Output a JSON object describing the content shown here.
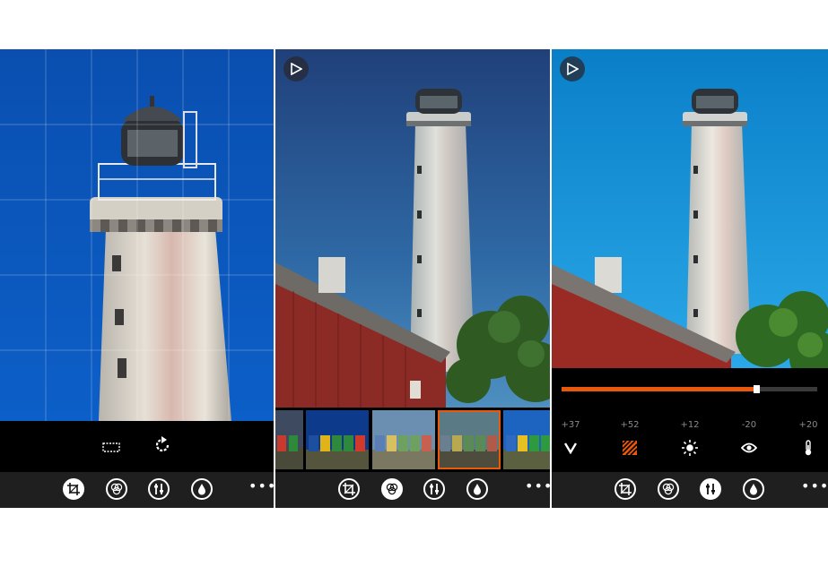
{
  "panels": [
    {
      "name": "crop",
      "tools": [
        {
          "icon": "crop-frame-icon"
        },
        {
          "icon": "rotate-icon"
        }
      ],
      "appbar_active": "crop"
    },
    {
      "name": "filters",
      "play_icon": "play-icon",
      "appbar_active": "filters",
      "filters": [
        {
          "selected": false
        },
        {
          "selected": false
        },
        {
          "selected": false
        },
        {
          "selected": true
        },
        {
          "selected": false
        }
      ]
    },
    {
      "name": "adjust",
      "play_icon": "play-icon",
      "appbar_active": "adjust",
      "slider": {
        "level": 0.76
      },
      "adjustments": [
        {
          "value": "+37",
          "icon": "vignette-v-icon"
        },
        {
          "value": "+52",
          "icon": "texture-stripes-icon"
        },
        {
          "value": "+12",
          "icon": "brightness-sun-icon"
        },
        {
          "value": "-20",
          "icon": "eye-icon"
        },
        {
          "value": "+20",
          "icon": "thermometer-icon"
        }
      ]
    }
  ],
  "appbar": {
    "buttons": [
      "crop-icon",
      "filters-icon",
      "adjust-icon",
      "color-drop-icon"
    ],
    "more": "•••"
  },
  "colors": {
    "accent": "#e8590c",
    "appbar": "#1f1f1f"
  }
}
